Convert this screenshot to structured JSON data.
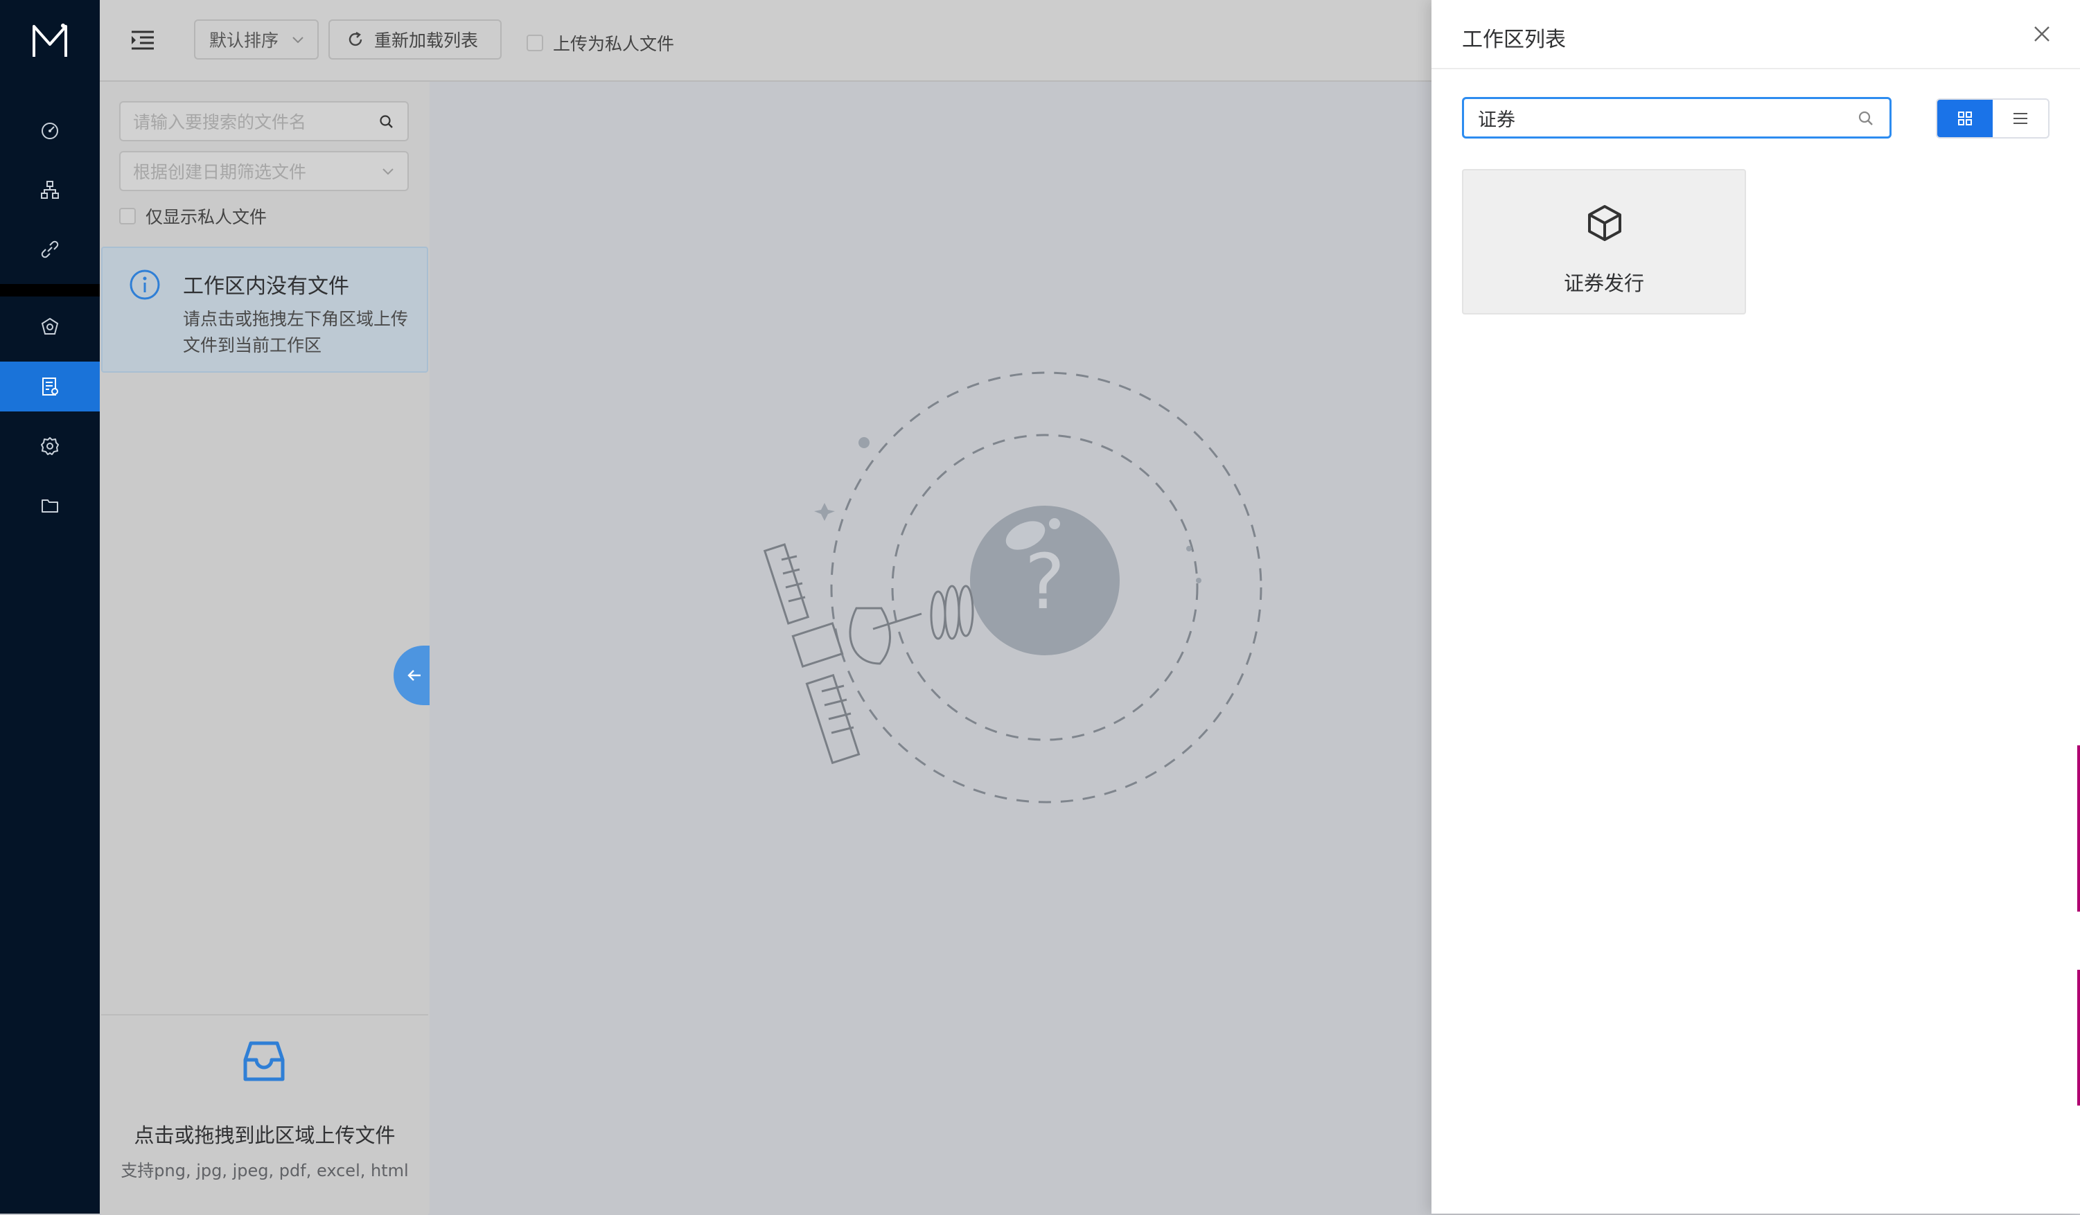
{
  "sidebar": {
    "logo_icon": "m-logo-icon",
    "items": [
      {
        "icon": "dashboard-icon"
      },
      {
        "icon": "org-chart-icon"
      },
      {
        "icon": "link-icon"
      },
      {
        "icon": "shield-icon"
      },
      {
        "icon": "document-list-icon",
        "active": true
      },
      {
        "icon": "gear-icon"
      },
      {
        "icon": "folder-icon"
      }
    ],
    "bg_color": "#041427",
    "active_color": "#1a73d9"
  },
  "toolbar": {
    "sort_label": "默认排序",
    "reload_label": "重新加载列表",
    "private_upload_label": "上传为私人文件"
  },
  "file_panel": {
    "search_placeholder": "请输入要搜索的文件名",
    "date_placeholder": "根据创建日期筛选文件",
    "private_only_label": "仅显示私人文件",
    "alert": {
      "title": "工作区内没有文件",
      "description": "请点击或拖拽左下角区域上传文件到当前工作区"
    },
    "upload": {
      "title": "点击或拖拽到此区域上传文件",
      "hint": "支持png, jpg, jpeg, pdf, excel, html"
    }
  },
  "drawer": {
    "title": "工作区列表",
    "search_value": "证券",
    "view_mode": "grid",
    "workspaces": [
      {
        "name": "证券发行",
        "icon": "cube-icon"
      }
    ]
  }
}
